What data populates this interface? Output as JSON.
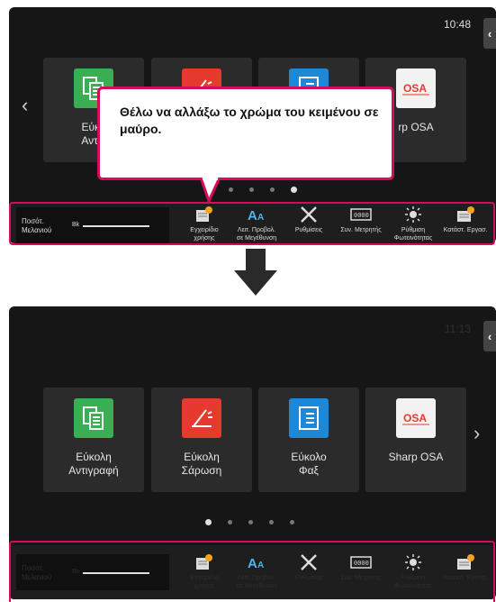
{
  "screen1": {
    "clock": "10:48",
    "side_tab": "‹",
    "tiles": [
      {
        "label": "Εύκολη Αντιγραφή",
        "visible_label": "Εύκο\nΑντιγ",
        "icon": "copy-icon",
        "color": "#3aae52"
      },
      {
        "label": "Εύκολη Σάρωση",
        "icon": "scan-icon",
        "color": "#e63a2e"
      },
      {
        "label": "Εύκολο Φαξ",
        "icon": "fax-icon",
        "color": "#1e88d6"
      },
      {
        "label": "Sharp OSA",
        "visible_label": "rp OSA",
        "icon": "osa-icon",
        "color": "#f2f2f2"
      }
    ],
    "callout_text": "Θέλω να αλλάξω το χρώμα του κειμένου σε μαύρο.",
    "prev_arrow": "‹"
  },
  "screen2": {
    "clock": "11:13",
    "side_tab": "‹",
    "tiles": [
      {
        "label": "Εύκολη\nΑντιγραφή",
        "icon": "copy-icon",
        "color": "#3aae52"
      },
      {
        "label": "Εύκολη\nΣάρωση",
        "icon": "scan-icon",
        "color": "#e63a2e"
      },
      {
        "label": "Εύκολο\nΦαξ",
        "icon": "fax-icon",
        "color": "#1e88d6"
      },
      {
        "label": "Sharp OSA",
        "icon": "osa-icon",
        "color": "#f2f2f2"
      }
    ],
    "next_arrow": "›"
  },
  "taskbar": {
    "ink_label": "Ποσότ.\nΜελανιού",
    "ink_color": "Bk",
    "items": [
      {
        "label": "Εγχειρίδιο\nχρήσης",
        "icon": "manual-icon"
      },
      {
        "label": "Λειτ. Προβολ.\nσε Μεγέθυνση",
        "icon": "text-size-icon"
      },
      {
        "label": "Ρυθμίσεις",
        "icon": "settings-tools-icon"
      },
      {
        "label": "Συν. Μετρητής",
        "icon": "counter-icon"
      },
      {
        "label": "Ρύθμιση\nΦωτεινότητας",
        "icon": "brightness-icon"
      },
      {
        "label": "Κατάστ. Εργασ.",
        "icon": "job-status-icon"
      }
    ]
  },
  "colors": {
    "highlight": "#d80a5a",
    "badge": "#f2a51c",
    "screen_bg": "#161616"
  }
}
